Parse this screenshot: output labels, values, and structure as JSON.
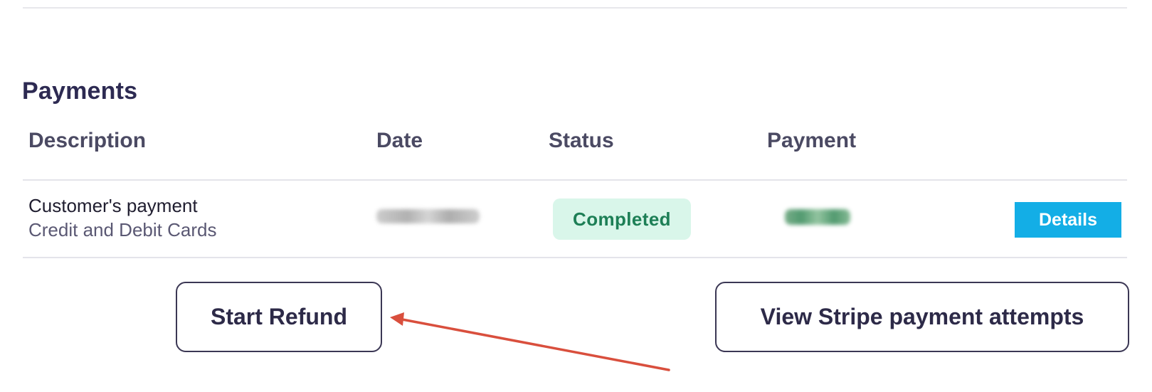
{
  "payments": {
    "title": "Payments",
    "columns": {
      "description": "Description",
      "date": "Date",
      "status": "Status",
      "payment": "Payment"
    },
    "rows": [
      {
        "description": "Customer's payment",
        "method": "Credit and Debit Cards",
        "date": "",
        "status": "Completed",
        "amount": "",
        "action_label": "Details"
      }
    ]
  },
  "actions": {
    "start_refund_label": "Start Refund",
    "view_stripe_label": "View Stripe payment attempts"
  },
  "colors": {
    "accent": "#13aee6",
    "status_bg": "#d9f6ea",
    "status_text": "#1d7f56",
    "annotation_arrow": "#d94f3d"
  },
  "annotation": {
    "icon": "arrow-icon"
  }
}
